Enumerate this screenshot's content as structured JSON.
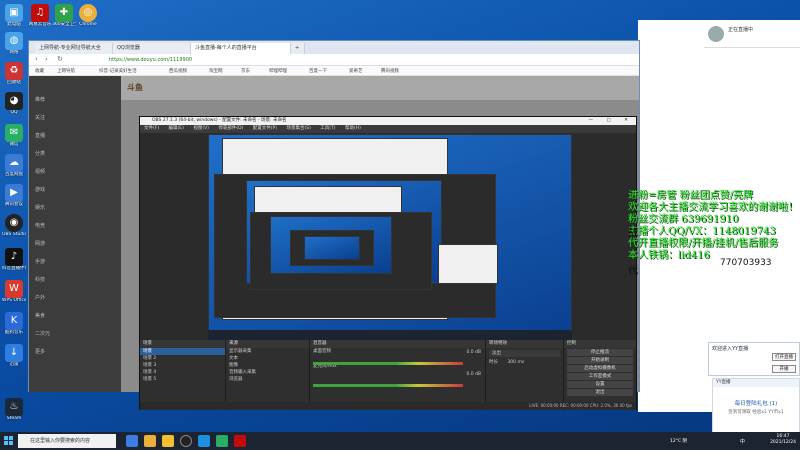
{
  "desktop": {
    "icons": [
      {
        "label": "此电脑",
        "color": "#4aa3e8"
      },
      {
        "label": "网络",
        "color": "#4aa3e8"
      },
      {
        "label": "回收站",
        "color": "#8aa"
      },
      {
        "label": "QQ",
        "color": "#1d1d1d"
      },
      {
        "label": "微信",
        "color": "#2aae67"
      },
      {
        "label": "百度网盘",
        "color": "#3a7bd5"
      },
      {
        "label": "腾讯会议",
        "color": "#3a7bd5"
      },
      {
        "label": "OBS Studio",
        "color": "#222"
      },
      {
        "label": "抖音直播伴侣",
        "color": "#111"
      },
      {
        "label": "WPS Office",
        "color": "#d83b2b"
      },
      {
        "label": "酷狗音乐",
        "color": "#2b6ad8"
      },
      {
        "label": "迅雷",
        "color": "#2f7de0"
      },
      {
        "label": "Steam",
        "color": "#1b2838"
      },
      {
        "label": "网易云音乐",
        "color": "#c20c0c"
      },
      {
        "label": "360安全卫士",
        "color": "#2fa14a"
      },
      {
        "label": "Chrome",
        "color": "#e9b03a"
      }
    ]
  },
  "browser": {
    "tabs": [
      "上网导航-专业网址导航大全",
      "QQ浏览器",
      "斗鱼直播-每个人的直播平台",
      "新标签页"
    ],
    "url": "https://www.douyu.com/1119900",
    "bookmarks": [
      "收藏",
      "上网导航",
      "抖音-记录美好生活",
      "西瓜视频",
      "淘宝网",
      "京东",
      "哔哩哔哩",
      "百度一下",
      "爱奇艺",
      "腾讯视频"
    ],
    "site_logo": "斗鱼",
    "sidebar_items": [
      "推荐",
      "关注",
      "直播",
      "分类",
      "视频",
      "游戏",
      "娱乐",
      "电竞",
      "网游",
      "手游",
      "科技",
      "户外",
      "美食",
      "二次元",
      "更多"
    ]
  },
  "obs": {
    "title": "OBS 27.1.3 (64-bit, windows) - 配置文件: 未命名 - 场景: 未命名",
    "menu": [
      "文件(F)",
      "编辑(E)",
      "视图(V)",
      "停靠部件(D)",
      "配置文件(P)",
      "场景集合(S)",
      "工具(T)",
      "帮助(H)"
    ],
    "window_controls": "— □ ✕",
    "docks": {
      "scenes": {
        "title": "场景",
        "items": [
          "场景",
          "场景 2",
          "场景 3",
          "场景 4",
          "场景 5"
        ]
      },
      "sources": {
        "title": "来源",
        "items": [
          "显示器采集",
          "文本",
          "图像",
          "音频输入采集",
          "浏览器"
        ]
      },
      "mixer": {
        "title": "混音器",
        "channels": [
          "桌面音频",
          "麦克风/Aux"
        ],
        "levels": [
          "0.0 dB",
          "0.0 dB"
        ]
      },
      "transitions": {
        "title": "转场特效",
        "type": "淡出",
        "duration_label": "时长",
        "duration": "300 ms"
      },
      "controls": {
        "title": "控制",
        "buttons": [
          "停止推流",
          "开始录制",
          "启动虚拟摄像机",
          "工作室模式",
          "设置",
          "退出"
        ]
      }
    },
    "status": "LIVE: 00:00:00   REC: 00:00:00   CPU: 2.0%, 30.00 fps"
  },
  "overlay": {
    "lines": [
      "进粉=房管   粉丝团点赞/亮牌",
      "欢迎各大主播交流学习喜欢的谢谢啦！",
      "粉丝交流群 639691910",
      "主播个人QQ/VX：1148019743",
      "代开直播权限/开播/挂机/售后服务",
      "本人铁锅：lid416"
    ],
    "extra_dark": [
      "战",
      "代"
    ],
    "number_partial": "770703933"
  },
  "right": {
    "chat_name": "正在直播中",
    "popup": {
      "title": "欢迎进入YY直播",
      "btn1": "打开直播",
      "btn2": "开播"
    },
    "notice": {
      "top": "YY直播",
      "title": "每日登陆礼包 (1)",
      "body": "签到可领取 经验x1 YY币x1"
    }
  },
  "taskbar": {
    "search_placeholder": "在这里输入你要搜索的内容",
    "weather": "12°C 阴",
    "time": "16:47",
    "date": "2021/12/24",
    "lang": "中"
  }
}
